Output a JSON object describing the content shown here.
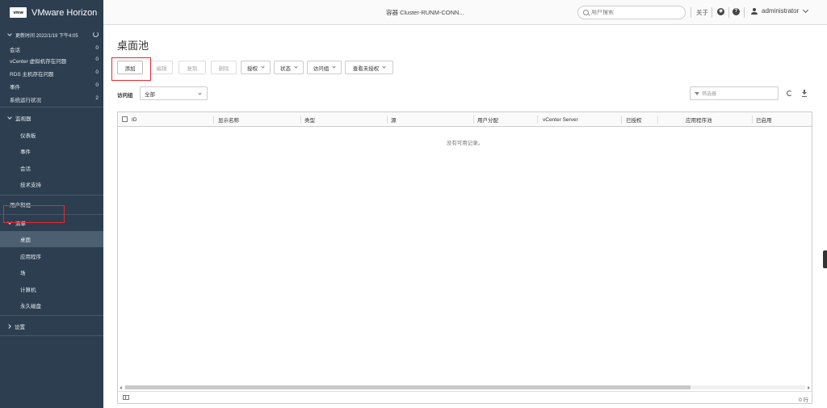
{
  "header": {
    "logo_text": "vmw",
    "app_title": "VMware Horizon",
    "container_label": "容器 Cluster-RUNM-CONN...",
    "search_placeholder": "用户搜索",
    "about_label": "关于",
    "user_name": "administrator"
  },
  "sidebar": {
    "update_label": "更新时间 2022/1/19 下午4:05",
    "stats": [
      {
        "label": "会话",
        "value": "0"
      },
      {
        "label": "vCenter 虚拟机存在问题",
        "value": "0"
      },
      {
        "label": "RDS 主机存在问题",
        "value": "0"
      },
      {
        "label": "事件",
        "value": "0"
      },
      {
        "label": "系统运行状况",
        "value": "2"
      }
    ],
    "monitor_section": "监视器",
    "monitor_items": [
      "仪表板",
      "事件",
      "会话",
      "技术支持"
    ],
    "users_groups": "用户和组",
    "inventory_section": "清单",
    "inventory_items": [
      "桌面",
      "应用程序",
      "场",
      "计算机",
      "永久磁盘"
    ],
    "settings_section": "设置"
  },
  "main": {
    "title": "桌面池",
    "toolbar": {
      "add": "添加",
      "edit": "编辑",
      "duplicate": "复制",
      "delete": "删除",
      "entitlements": "授权",
      "status": "状态",
      "access_group": "访问组",
      "view_unentitled": "查看未授权"
    },
    "access_group_label": "访问组",
    "access_group_value": "全部",
    "filter_placeholder": "筛选器",
    "columns": [
      "ID",
      "显示名称",
      "类型",
      "源",
      "用户分配",
      "vCenter Server",
      "已授权",
      "应用程序池",
      "已启用"
    ],
    "empty_message": "没有可用记录。",
    "row_count": "0 行"
  }
}
